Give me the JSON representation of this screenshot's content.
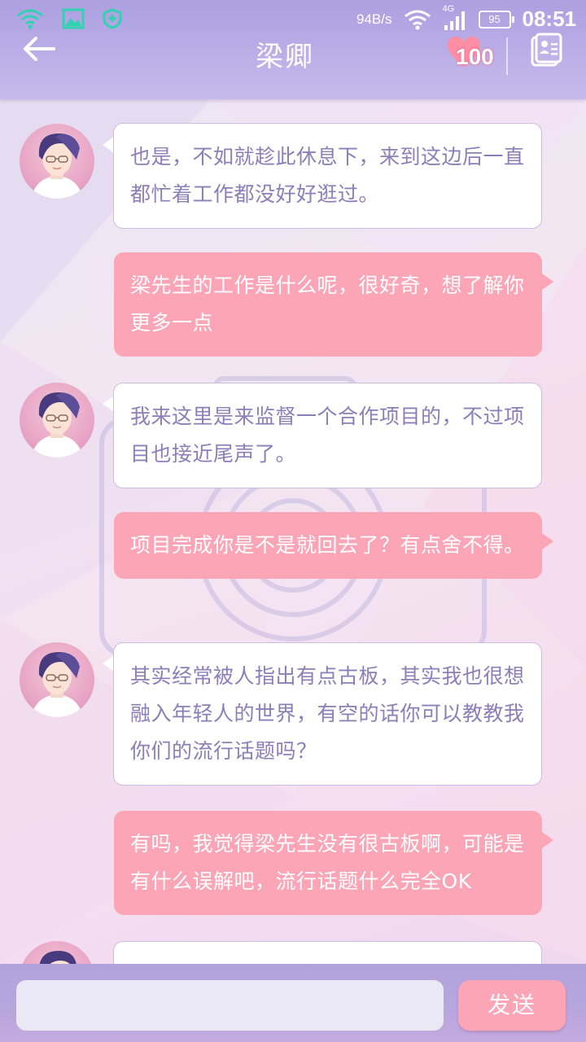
{
  "status_bar": {
    "net_speed": "94B/s",
    "net_type": "4G",
    "battery": "95",
    "time": "08:51",
    "icons": [
      "wifi-icon",
      "image-icon",
      "shield-icon",
      "wifi-icon",
      "signal-icon",
      "battery-icon"
    ]
  },
  "header": {
    "title": "梁卿",
    "affection": "100",
    "icons": [
      "back-arrow-icon",
      "heart-icon",
      "contact-card-icon"
    ]
  },
  "messages": [
    {
      "side": "left",
      "text": "也是，不如就趁此休息下，来到这边后一直都忙着工作都没好好逛过。"
    },
    {
      "side": "right",
      "text": "梁先生的工作是什么呢，很好奇，想了解你更多一点"
    },
    {
      "side": "left",
      "text": "我来这里是来监督一个合作项目的，不过项目也接近尾声了。"
    },
    {
      "side": "right",
      "text": "项目完成你是不是就回去了？有点舍不得。"
    },
    {
      "side": "left",
      "text": "其实经常被人指出有点古板，其实我也很想融入年轻人的世界，有空的话你可以教教我你们的流行话题吗？"
    },
    {
      "side": "right",
      "text": "有吗，我觉得梁先生没有很古板啊，可能是有什么误解吧，流行话题什么完全OK"
    },
    {
      "side": "left",
      "text": ""
    }
  ],
  "composer": {
    "value": "",
    "placeholder": "",
    "send_label": "发送"
  },
  "colors": {
    "header": "#b3a6e3",
    "bubble_right": "#fca5b6",
    "bubble_left": "#ffffff",
    "left_text": "#8a7fb8"
  }
}
